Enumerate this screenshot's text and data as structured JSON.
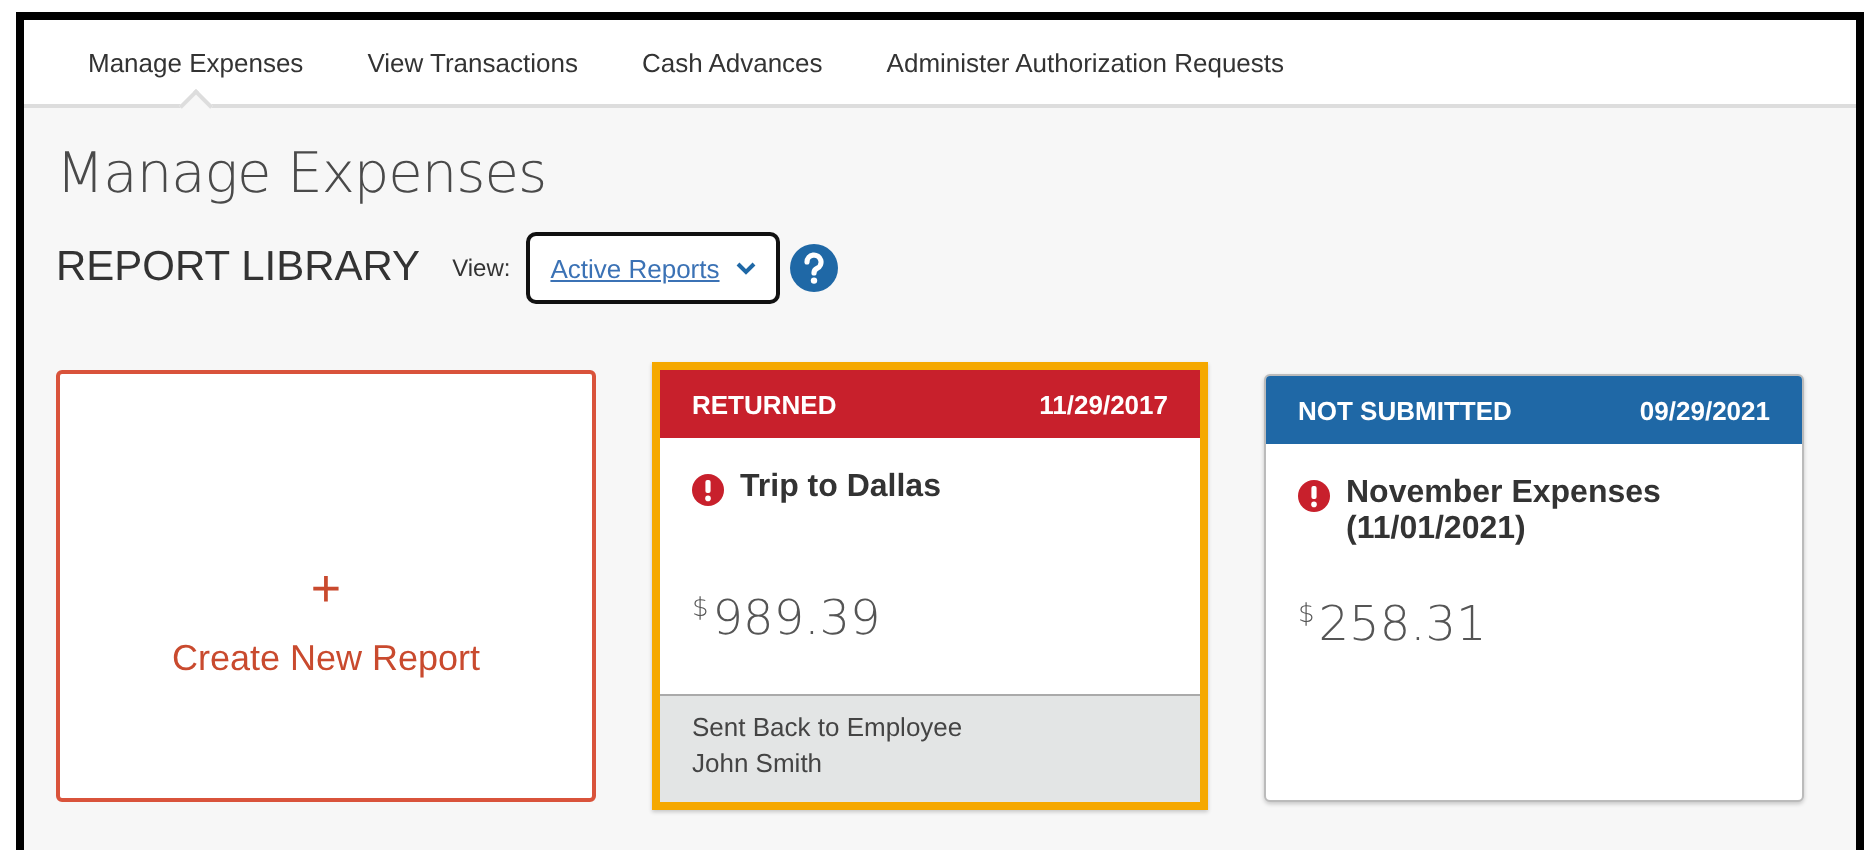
{
  "tabs": [
    {
      "label": "Manage Expenses",
      "selected": true
    },
    {
      "label": "View Transactions",
      "selected": false
    },
    {
      "label": "Cash Advances",
      "selected": false
    },
    {
      "label": "Administer Authorization Requests",
      "selected": false
    }
  ],
  "page_title": "Manage Expenses",
  "library": {
    "heading": "REPORT LIBRARY",
    "view_label": "View:",
    "view_value": "Active Reports"
  },
  "cards": [
    {
      "kind": "create",
      "icon": "+",
      "label": "Create New Report",
      "selected": false
    },
    {
      "kind": "report",
      "status": "RETURNED",
      "date": "11/29/2017",
      "color": "#c8202c",
      "alert": true,
      "name": "Trip to Dallas",
      "currency": "$",
      "amount": "989.39",
      "footer": [
        "Sent Back to Employee",
        "John Smith"
      ],
      "selected": true
    },
    {
      "kind": "report",
      "status": "NOT SUBMITTED",
      "date": "09/29/2021",
      "color": "#1f68a6",
      "alert": true,
      "name": "November Expenses (11/01/2021)",
      "currency": "$",
      "amount": "258.31",
      "selected": false
    }
  ]
}
